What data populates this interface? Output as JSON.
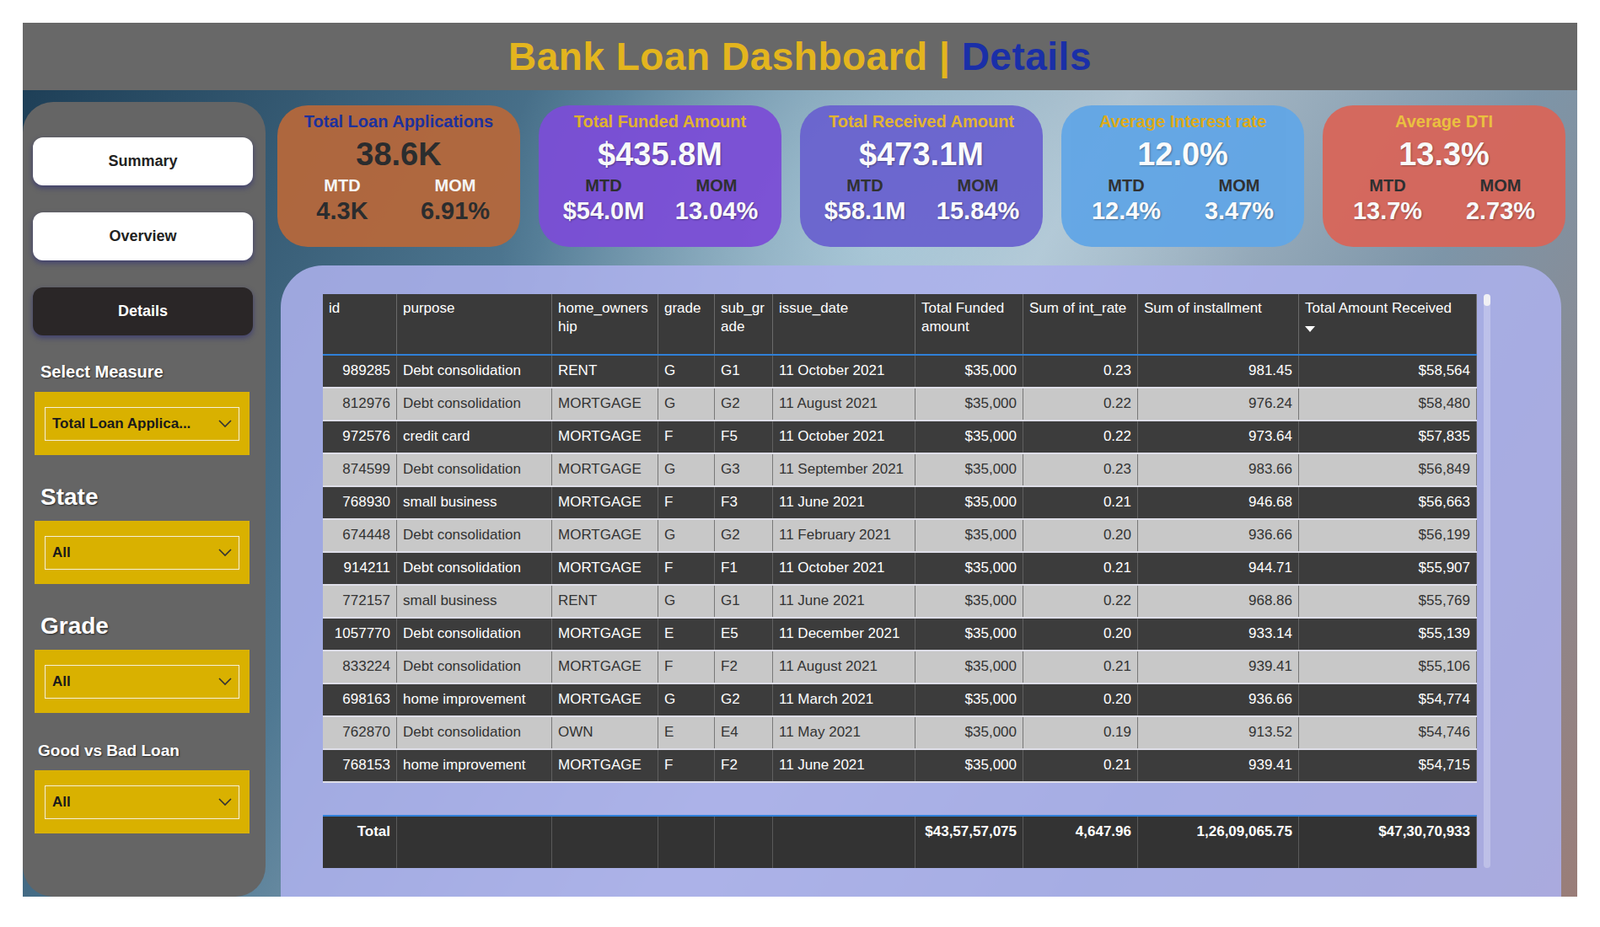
{
  "header": {
    "title": "Bank Loan Dashboard |",
    "page": "Details"
  },
  "nav": [
    {
      "label": "Summary",
      "selected": false
    },
    {
      "label": "Overview",
      "selected": false
    },
    {
      "label": "Details",
      "selected": true
    }
  ],
  "filters": [
    {
      "label": "Select Measure",
      "value": "Total Loan Applica..."
    },
    {
      "label": "State",
      "value": "All"
    },
    {
      "label": "Grade",
      "value": "All"
    },
    {
      "label": "Good vs Bad Loan",
      "value": "All"
    }
  ],
  "kpis": [
    {
      "title": "Total Loan Applications",
      "value": "38.6K",
      "mtd_label": "MTD",
      "mtd": "4.3K",
      "mom_label": "MOM",
      "mom": "6.91%",
      "color": "#b5683c",
      "title_color": "#1c2f9e"
    },
    {
      "title": "Total Funded Amount",
      "value": "$435.8M",
      "mtd_label": "MTD",
      "mtd": "$54.0M",
      "mom_label": "MOM",
      "mom": "13.04%",
      "color": "#7b4ed6",
      "title_color": "#e6b52a"
    },
    {
      "title": "Total Received Amount",
      "value": "$473.1M",
      "mtd_label": "MTD",
      "mtd": "$58.1M",
      "mom_label": "MOM",
      "mom": "15.84%",
      "color": "#6a63cf",
      "title_color": "#e6b52a"
    },
    {
      "title": "Average Interest rate",
      "value": "12.0%",
      "mtd_label": "MTD",
      "mtd": "12.4%",
      "mom_label": "MOM",
      "mom": "3.47%",
      "color": "#62a6e6",
      "title_color": "#e0aa10"
    },
    {
      "title": "Average DTI",
      "value": "13.3%",
      "mtd_label": "MTD",
      "mtd": "13.7%",
      "mom_label": "MOM",
      "mom": "2.73%",
      "color": "#d8665a",
      "title_color": "#f0c23a"
    }
  ],
  "table": {
    "columns": [
      {
        "label": "id",
        "sorted": false
      },
      {
        "label": "purpose",
        "sorted": false
      },
      {
        "label": "home_ownership",
        "sorted": false
      },
      {
        "label": "grade",
        "sorted": false
      },
      {
        "label": "sub_grade",
        "sorted": false
      },
      {
        "label": "issue_date",
        "sorted": false
      },
      {
        "label": "Total Funded amount",
        "sorted": false
      },
      {
        "label": "Sum of int_rate",
        "sorted": false
      },
      {
        "label": "Sum of installment",
        "sorted": false
      },
      {
        "label": "Total Amount Received",
        "sorted": true
      }
    ],
    "rows": [
      [
        "989285",
        "Debt consolidation",
        "RENT",
        "G",
        "G1",
        "11 October 2021",
        "$35,000",
        "0.23",
        "981.45",
        "$58,564"
      ],
      [
        "812976",
        "Debt consolidation",
        "MORTGAGE",
        "G",
        "G2",
        "11 August 2021",
        "$35,000",
        "0.22",
        "976.24",
        "$58,480"
      ],
      [
        "972576",
        "credit card",
        "MORTGAGE",
        "F",
        "F5",
        "11 October 2021",
        "$35,000",
        "0.22",
        "973.64",
        "$57,835"
      ],
      [
        "874599",
        "Debt consolidation",
        "MORTGAGE",
        "G",
        "G3",
        "11 September 2021",
        "$35,000",
        "0.23",
        "983.66",
        "$56,849"
      ],
      [
        "768930",
        "small business",
        "MORTGAGE",
        "F",
        "F3",
        "11 June 2021",
        "$35,000",
        "0.21",
        "946.68",
        "$56,663"
      ],
      [
        "674448",
        "Debt consolidation",
        "MORTGAGE",
        "G",
        "G2",
        "11 February 2021",
        "$35,000",
        "0.20",
        "936.66",
        "$56,199"
      ],
      [
        "914211",
        "Debt consolidation",
        "MORTGAGE",
        "F",
        "F1",
        "11 October 2021",
        "$35,000",
        "0.21",
        "944.71",
        "$55,907"
      ],
      [
        "772157",
        "small business",
        "RENT",
        "G",
        "G1",
        "11 June 2021",
        "$35,000",
        "0.22",
        "968.86",
        "$55,769"
      ],
      [
        "1057770",
        "Debt consolidation",
        "MORTGAGE",
        "E",
        "E5",
        "11 December 2021",
        "$35,000",
        "0.20",
        "933.14",
        "$55,139"
      ],
      [
        "833224",
        "Debt consolidation",
        "MORTGAGE",
        "F",
        "F2",
        "11 August 2021",
        "$35,000",
        "0.21",
        "939.41",
        "$55,106"
      ],
      [
        "698163",
        "home improvement",
        "MORTGAGE",
        "G",
        "G2",
        "11 March 2021",
        "$35,000",
        "0.20",
        "936.66",
        "$54,774"
      ],
      [
        "762870",
        "Debt consolidation",
        "OWN",
        "E",
        "E4",
        "11 May 2021",
        "$35,000",
        "0.19",
        "913.52",
        "$54,746"
      ],
      [
        "768153",
        "home improvement",
        "MORTGAGE",
        "F",
        "F2",
        "11 June 2021",
        "$35,000",
        "0.21",
        "939.41",
        "$54,715"
      ]
    ],
    "total": [
      "Total",
      "",
      "",
      "",
      "",
      "",
      "$43,57,57,075",
      "4,647.96",
      "1,26,09,065.75",
      "$47,30,70,933"
    ]
  }
}
